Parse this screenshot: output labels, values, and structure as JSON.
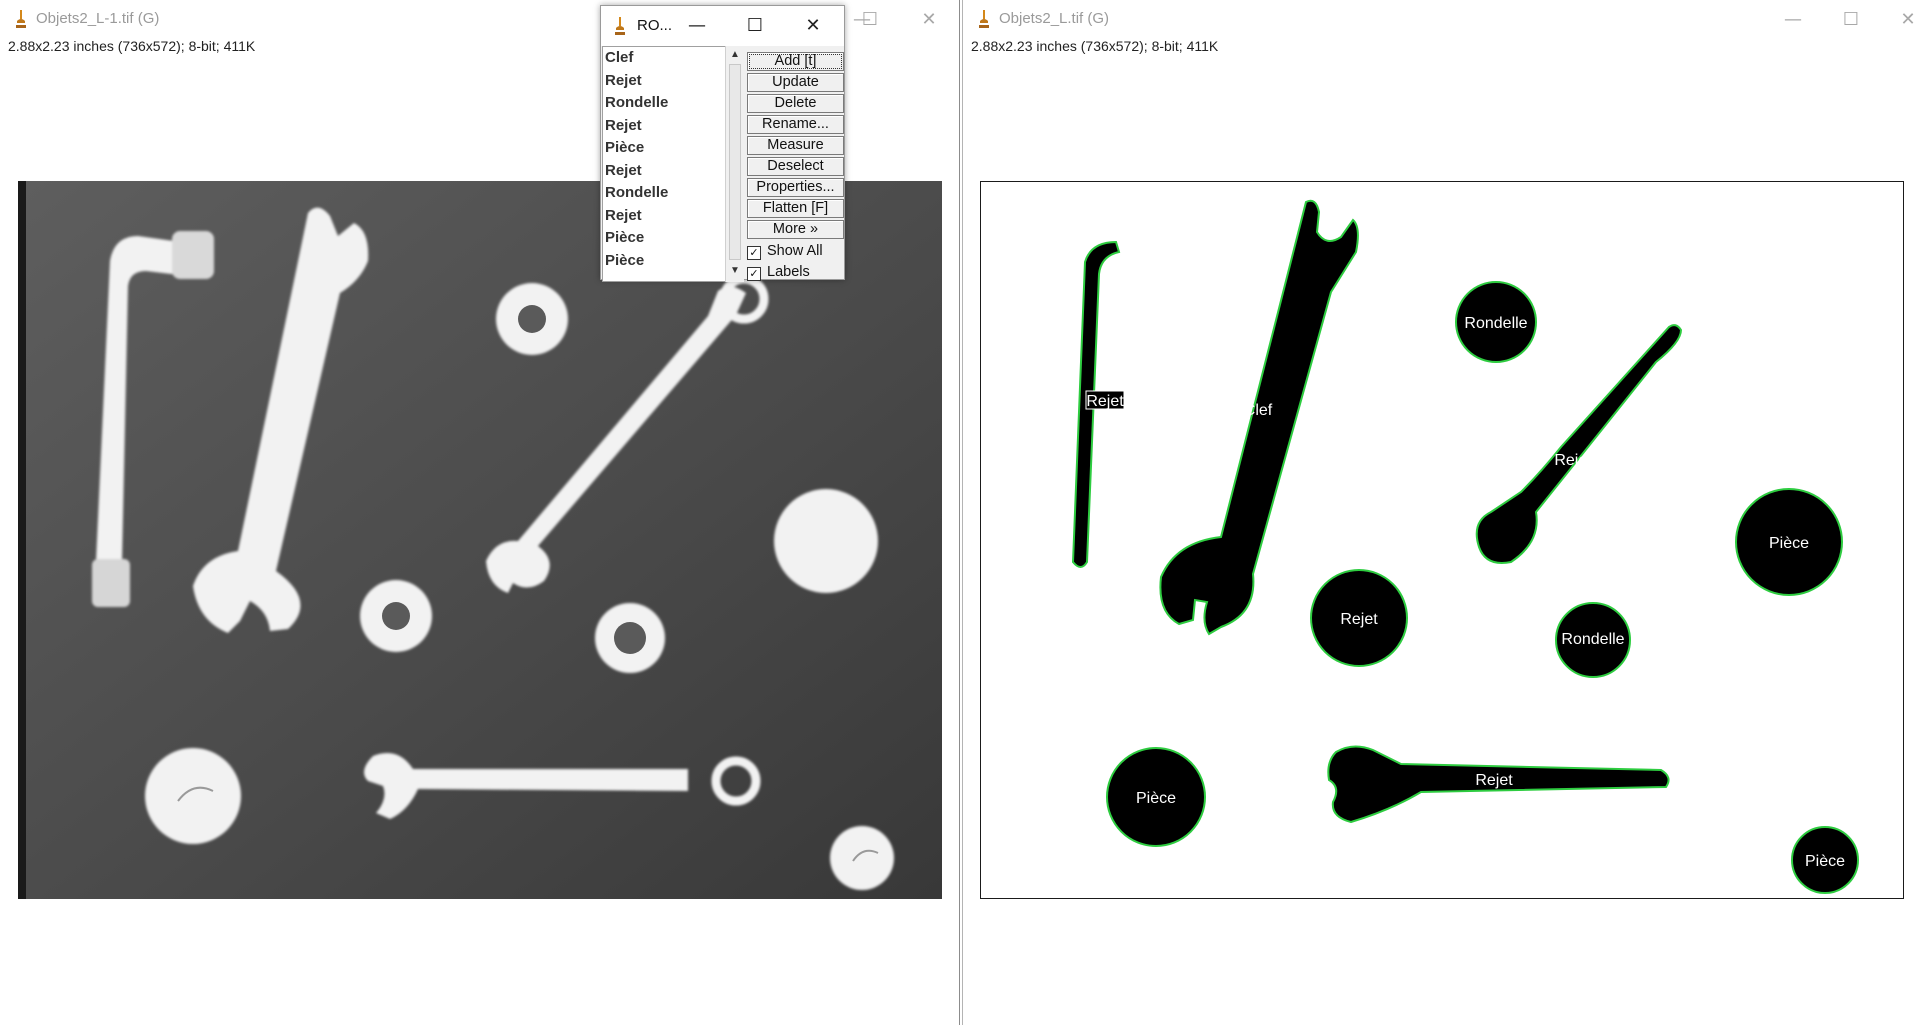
{
  "left_window": {
    "title": "Objets2_L-1.tif (G)",
    "info": "2.88x2.23 inches (736x572); 8-bit; 411K",
    "icon": "imagej-microscope-icon",
    "controls": {
      "minimize": "—",
      "maximize": "☐",
      "close": "✕"
    }
  },
  "right_window": {
    "title": "Objets2_L.tif (G)",
    "info": "2.88x2.23 inches (736x572); 8-bit; 411K",
    "icon": "imagej-microscope-icon",
    "controls": {
      "minimize": "—",
      "maximize": "☐",
      "close": "✕"
    },
    "labels": [
      "Rejet",
      "Clef",
      "Rondelle",
      "Rejet",
      "Pièce",
      "Rejet",
      "Rondelle",
      "Pièce",
      "Rejet",
      "Pièce"
    ]
  },
  "roi_manager": {
    "title": "RO...",
    "controls": {
      "minimize": "—",
      "maximize": "☐",
      "close": "✕"
    },
    "items": [
      "Clef",
      "Rejet",
      "Rondelle",
      "Rejet",
      "Pièce",
      "Rejet",
      "Rondelle",
      "Rejet",
      "Pièce",
      "Pièce"
    ],
    "buttons": {
      "add": "Add [t]",
      "update": "Update",
      "delete": "Delete",
      "rename": "Rename...",
      "measure": "Measure",
      "deselect": "Deselect",
      "properties": "Properties...",
      "flatten": "Flatten [F]",
      "more": "More »"
    },
    "checkboxes": {
      "show_all": {
        "label": "Show All",
        "checked": true
      },
      "labels": {
        "label": "Labels",
        "checked": true
      }
    }
  },
  "colors": {
    "outline": "#2ecc40",
    "object_fill": "#000000",
    "photo_background": "#4a4a4a"
  }
}
